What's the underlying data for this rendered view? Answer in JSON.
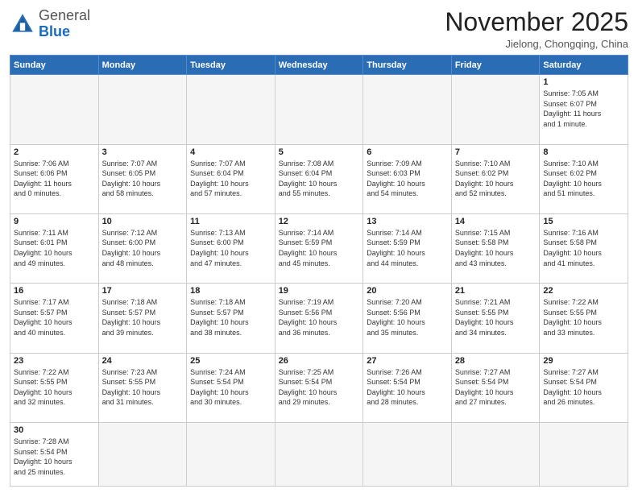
{
  "logo": {
    "general": "General",
    "blue": "Blue"
  },
  "title": "November 2025",
  "subtitle": "Jielong, Chongqing, China",
  "days_of_week": [
    "Sunday",
    "Monday",
    "Tuesday",
    "Wednesday",
    "Thursday",
    "Friday",
    "Saturday"
  ],
  "weeks": [
    [
      {
        "day": "",
        "info": ""
      },
      {
        "day": "",
        "info": ""
      },
      {
        "day": "",
        "info": ""
      },
      {
        "day": "",
        "info": ""
      },
      {
        "day": "",
        "info": ""
      },
      {
        "day": "",
        "info": ""
      },
      {
        "day": "1",
        "info": "Sunrise: 7:05 AM\nSunset: 6:07 PM\nDaylight: 11 hours\nand 1 minute."
      }
    ],
    [
      {
        "day": "2",
        "info": "Sunrise: 7:06 AM\nSunset: 6:06 PM\nDaylight: 11 hours\nand 0 minutes."
      },
      {
        "day": "3",
        "info": "Sunrise: 7:07 AM\nSunset: 6:05 PM\nDaylight: 10 hours\nand 58 minutes."
      },
      {
        "day": "4",
        "info": "Sunrise: 7:07 AM\nSunset: 6:04 PM\nDaylight: 10 hours\nand 57 minutes."
      },
      {
        "day": "5",
        "info": "Sunrise: 7:08 AM\nSunset: 6:04 PM\nDaylight: 10 hours\nand 55 minutes."
      },
      {
        "day": "6",
        "info": "Sunrise: 7:09 AM\nSunset: 6:03 PM\nDaylight: 10 hours\nand 54 minutes."
      },
      {
        "day": "7",
        "info": "Sunrise: 7:10 AM\nSunset: 6:02 PM\nDaylight: 10 hours\nand 52 minutes."
      },
      {
        "day": "8",
        "info": "Sunrise: 7:10 AM\nSunset: 6:02 PM\nDaylight: 10 hours\nand 51 minutes."
      }
    ],
    [
      {
        "day": "9",
        "info": "Sunrise: 7:11 AM\nSunset: 6:01 PM\nDaylight: 10 hours\nand 49 minutes."
      },
      {
        "day": "10",
        "info": "Sunrise: 7:12 AM\nSunset: 6:00 PM\nDaylight: 10 hours\nand 48 minutes."
      },
      {
        "day": "11",
        "info": "Sunrise: 7:13 AM\nSunset: 6:00 PM\nDaylight: 10 hours\nand 47 minutes."
      },
      {
        "day": "12",
        "info": "Sunrise: 7:14 AM\nSunset: 5:59 PM\nDaylight: 10 hours\nand 45 minutes."
      },
      {
        "day": "13",
        "info": "Sunrise: 7:14 AM\nSunset: 5:59 PM\nDaylight: 10 hours\nand 44 minutes."
      },
      {
        "day": "14",
        "info": "Sunrise: 7:15 AM\nSunset: 5:58 PM\nDaylight: 10 hours\nand 43 minutes."
      },
      {
        "day": "15",
        "info": "Sunrise: 7:16 AM\nSunset: 5:58 PM\nDaylight: 10 hours\nand 41 minutes."
      }
    ],
    [
      {
        "day": "16",
        "info": "Sunrise: 7:17 AM\nSunset: 5:57 PM\nDaylight: 10 hours\nand 40 minutes."
      },
      {
        "day": "17",
        "info": "Sunrise: 7:18 AM\nSunset: 5:57 PM\nDaylight: 10 hours\nand 39 minutes."
      },
      {
        "day": "18",
        "info": "Sunrise: 7:18 AM\nSunset: 5:57 PM\nDaylight: 10 hours\nand 38 minutes."
      },
      {
        "day": "19",
        "info": "Sunrise: 7:19 AM\nSunset: 5:56 PM\nDaylight: 10 hours\nand 36 minutes."
      },
      {
        "day": "20",
        "info": "Sunrise: 7:20 AM\nSunset: 5:56 PM\nDaylight: 10 hours\nand 35 minutes."
      },
      {
        "day": "21",
        "info": "Sunrise: 7:21 AM\nSunset: 5:55 PM\nDaylight: 10 hours\nand 34 minutes."
      },
      {
        "day": "22",
        "info": "Sunrise: 7:22 AM\nSunset: 5:55 PM\nDaylight: 10 hours\nand 33 minutes."
      }
    ],
    [
      {
        "day": "23",
        "info": "Sunrise: 7:22 AM\nSunset: 5:55 PM\nDaylight: 10 hours\nand 32 minutes."
      },
      {
        "day": "24",
        "info": "Sunrise: 7:23 AM\nSunset: 5:55 PM\nDaylight: 10 hours\nand 31 minutes."
      },
      {
        "day": "25",
        "info": "Sunrise: 7:24 AM\nSunset: 5:54 PM\nDaylight: 10 hours\nand 30 minutes."
      },
      {
        "day": "26",
        "info": "Sunrise: 7:25 AM\nSunset: 5:54 PM\nDaylight: 10 hours\nand 29 minutes."
      },
      {
        "day": "27",
        "info": "Sunrise: 7:26 AM\nSunset: 5:54 PM\nDaylight: 10 hours\nand 28 minutes."
      },
      {
        "day": "28",
        "info": "Sunrise: 7:27 AM\nSunset: 5:54 PM\nDaylight: 10 hours\nand 27 minutes."
      },
      {
        "day": "29",
        "info": "Sunrise: 7:27 AM\nSunset: 5:54 PM\nDaylight: 10 hours\nand 26 minutes."
      }
    ],
    [
      {
        "day": "30",
        "info": "Sunrise: 7:28 AM\nSunset: 5:54 PM\nDaylight: 10 hours\nand 25 minutes."
      },
      {
        "day": "",
        "info": ""
      },
      {
        "day": "",
        "info": ""
      },
      {
        "day": "",
        "info": ""
      },
      {
        "day": "",
        "info": ""
      },
      {
        "day": "",
        "info": ""
      },
      {
        "day": "",
        "info": ""
      }
    ]
  ]
}
